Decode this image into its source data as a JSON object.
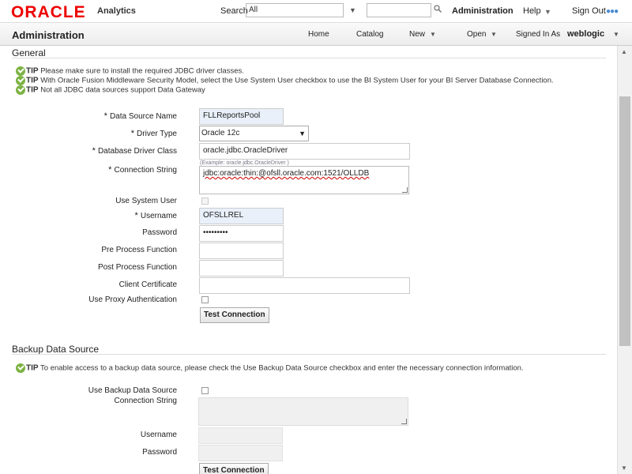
{
  "header": {
    "logo": "ORACLE",
    "product": "Analytics",
    "search_label": "Search",
    "search_scope": "All",
    "links": {
      "administration": "Administration",
      "help": "Help",
      "signout": "Sign Out"
    }
  },
  "titlebar": {
    "title": "Administration",
    "nav": {
      "home": "Home",
      "catalog": "Catalog",
      "new": "New",
      "open": "Open",
      "signed_in_as": "Signed In As",
      "user": "weblogic"
    }
  },
  "general": {
    "heading": "General",
    "tips": [
      {
        "label": "TIP",
        "text": " Please make sure to install the required JDBC driver classes."
      },
      {
        "label": "TIP",
        "text": " With Oracle Fusion Middleware Security Model, select the Use System User checkbox to use the BI System User for your BI Server Database Connection."
      },
      {
        "label": "TIP",
        "text": " Not all JDBC data sources support Data Gateway"
      }
    ],
    "fields": {
      "data_source_name": {
        "label": "Data Source Name",
        "value": "FLLReportsPool"
      },
      "driver_type": {
        "label": "Driver Type",
        "value": "Oracle 12c"
      },
      "database_driver_class": {
        "label": "Database Driver Class",
        "value": "oracle.jdbc.OracleDriver",
        "hint": "(Example: oracle.jdbc.OracleDriver )"
      },
      "connection_string": {
        "label": "Connection String",
        "value": "jdbc:oracle:thin:@ofsll.oracle.com:1521/OLLDB"
      },
      "use_system_user": {
        "label": "Use System User"
      },
      "username": {
        "label": "Username",
        "value": "OFSLLREL"
      },
      "password": {
        "label": "Password",
        "value": "•••••••••"
      },
      "pre_process": {
        "label": "Pre Process Function",
        "value": ""
      },
      "post_process": {
        "label": "Post Process Function",
        "value": ""
      },
      "client_certificate": {
        "label": "Client Certificate",
        "value": ""
      },
      "use_proxy": {
        "label": "Use Proxy Authentication"
      }
    },
    "test_button": "Test Connection"
  },
  "backup": {
    "heading": "Backup Data Source",
    "tip": {
      "label": "TIP",
      "text": " To enable access to a backup data source, please check the Use Backup Data Source checkbox and enter the necessary connection information."
    },
    "fields": {
      "use_backup": {
        "label": "Use Backup Data Source"
      },
      "connection_string": {
        "label": "Connection String",
        "value": ""
      },
      "username": {
        "label": "Username",
        "value": ""
      },
      "password": {
        "label": "Password",
        "value": ""
      }
    },
    "test_button": "Test Connection"
  },
  "colors": {
    "brand": "#e00000",
    "tip_icon": "#7cb342",
    "highlight_field": "#e9f0fa"
  }
}
